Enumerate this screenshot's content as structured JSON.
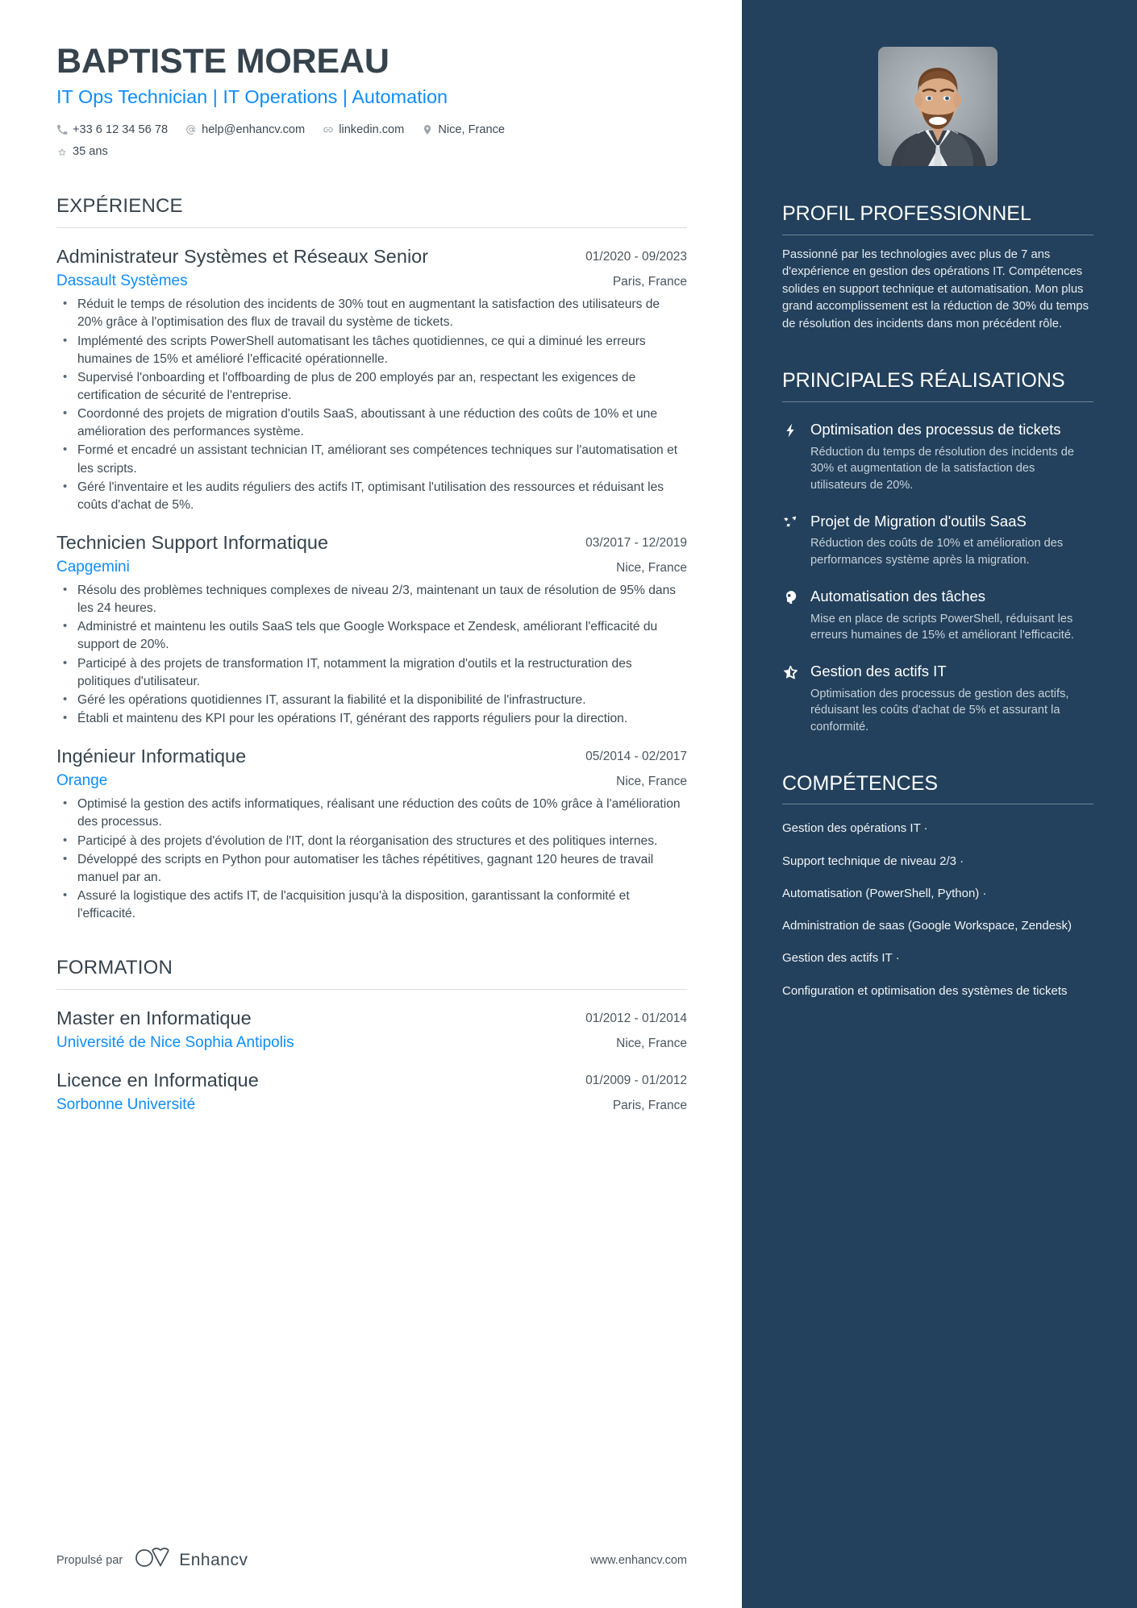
{
  "header": {
    "name": "BAPTISTE MOREAU",
    "headline": "IT Ops Technician | IT Operations | Automation",
    "contacts": [
      {
        "icon": "phone-icon",
        "text": "+33 6 12 34 56 78"
      },
      {
        "icon": "email-icon",
        "text": "help@enhancv.com"
      },
      {
        "icon": "link-icon",
        "text": "linkedin.com"
      },
      {
        "icon": "location-pin-icon",
        "text": "Nice, France"
      },
      {
        "icon": "star-icon",
        "text": "35 ans"
      }
    ]
  },
  "experience": {
    "title": "EXPÉRIENCE",
    "entries": [
      {
        "role": "Administrateur Systèmes et Réseaux Senior",
        "date": "01/2020 - 09/2023",
        "company": "Dassault Systèmes",
        "location": "Paris, France",
        "bullets": [
          "Réduit le temps de résolution des incidents de 30% tout en augmentant la satisfaction des utilisateurs de 20% grâce à l'optimisation des flux de travail du système de tickets.",
          "Implémenté des scripts PowerShell automatisant les tâches quotidiennes, ce qui a diminué les erreurs humaines de 15% et amélioré l'efficacité opérationnelle.",
          "Supervisé l'onboarding et l'offboarding de plus de 200 employés par an, respectant les exigences de certification de sécurité de l'entreprise.",
          "Coordonné des projets de migration d'outils SaaS, aboutissant à une réduction des coûts de 10% et une amélioration des performances système.",
          "Formé et encadré un assistant technician IT, améliorant ses compétences techniques sur l'automatisation et les scripts.",
          "Géré l'inventaire et les audits réguliers des actifs IT, optimisant l'utilisation des ressources et réduisant les coûts d'achat de 5%."
        ]
      },
      {
        "role": "Technicien Support Informatique",
        "date": "03/2017 - 12/2019",
        "company": "Capgemini",
        "location": "Nice, France",
        "bullets": [
          "Résolu des problèmes techniques complexes de niveau 2/3, maintenant un taux de résolution de 95% dans les 24 heures.",
          "Administré et maintenu les outils SaaS tels que Google Workspace et Zendesk, améliorant l'efficacité du support de 20%.",
          "Participé à des projets de transformation IT, notamment la migration d'outils et la restructuration des politiques d'utilisateur.",
          "Géré les opérations quotidiennes IT, assurant la fiabilité et la disponibilité de l'infrastructure.",
          "Établi et maintenu des KPI pour les opérations IT, générant des rapports réguliers pour la direction."
        ]
      },
      {
        "role": "Ingénieur Informatique",
        "date": "05/2014 - 02/2017",
        "company": "Orange",
        "location": "Nice, France",
        "bullets": [
          "Optimisé la gestion des actifs informatiques, réalisant une réduction des coûts de 10% grâce à l'amélioration des processus.",
          "Participé à des projets d'évolution de l'IT, dont la réorganisation des structures et des politiques internes.",
          "Développé des scripts en Python pour automatiser les tâches répétitives, gagnant 120 heures de travail manuel par an.",
          "Assuré la logistique des actifs IT, de l'acquisition jusqu'à la disposition, garantissant la conformité et l'efficacité."
        ]
      }
    ]
  },
  "education": {
    "title": "FORMATION",
    "entries": [
      {
        "degree": "Master en Informatique",
        "date": "01/2012 - 01/2014",
        "school": "Université de Nice Sophia Antipolis",
        "location": "Nice, France"
      },
      {
        "degree": "Licence en Informatique",
        "date": "01/2009 - 01/2012",
        "school": "Sorbonne Université",
        "location": "Paris, France"
      }
    ]
  },
  "footer": {
    "powered_by": "Propulsé par",
    "brand": "Enhancv",
    "url": "www.enhancv.com"
  },
  "sidebar": {
    "profile": {
      "title": "PROFIL PROFESSIONNEL",
      "text": "Passionné par les technologies avec plus de 7 ans d'expérience en gestion des opérations IT. Compétences solides en support technique et automatisation. Mon plus grand accomplissement est la réduction de 30% du temps de résolution des incidents dans mon précédent rôle."
    },
    "achievements": {
      "title": "PRINCIPALES RÉALISATIONS",
      "items": [
        {
          "icon": "lightning-bolt-icon",
          "title": "Optimisation des processus de tickets",
          "desc": "Réduction du temps de résolution des incidents de 30% et augmentation de la satisfaction des utilisateurs de 20%."
        },
        {
          "icon": "shooting-arrow-icon",
          "title": "Projet de Migration d'outils SaaS",
          "desc": "Réduction des coûts de 10% et amélioration des performances système après la migration."
        },
        {
          "icon": "head-brain-icon",
          "title": "Automatisation des tâches",
          "desc": "Mise en place de scripts PowerShell, réduisant les erreurs humaines de 15% et améliorant l'efficacité."
        },
        {
          "icon": "half-star-icon",
          "title": "Gestion des actifs IT",
          "desc": "Optimisation des processus de gestion des actifs, réduisant les coûts d'achat de 5% et assurant la conformité."
        }
      ]
    },
    "skills": {
      "title": "COMPÉTENCES",
      "items": [
        "Gestion des opérations IT ·",
        "Support technique de niveau 2/3 ·",
        "Automatisation (PowerShell, Python) ·",
        "Administration de saas (Google Workspace, Zendesk)",
        "Gestion des actifs IT ·",
        "Configuration et optimisation des systèmes de tickets"
      ]
    }
  },
  "colors": {
    "sidebar_navy": "#23415c",
    "accent_blue": "#0f8df9",
    "heading_dark": "#36434d",
    "body_text": "#3d4a54"
  }
}
